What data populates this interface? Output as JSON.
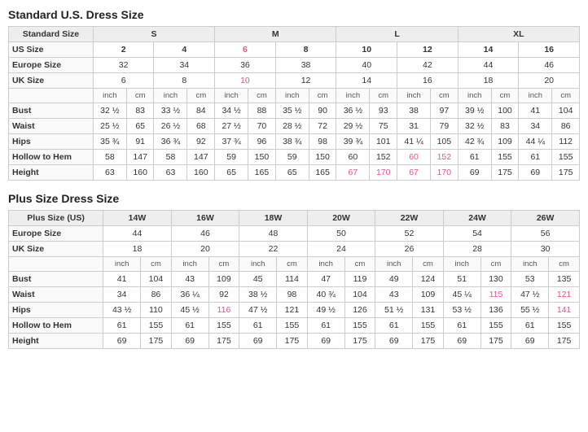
{
  "standard": {
    "title": "Standard U.S. Dress Size",
    "sizeGroups": [
      {
        "label": "Standard Size",
        "span": 1
      },
      {
        "label": "S",
        "span": 4
      },
      {
        "label": "M",
        "span": 4
      },
      {
        "label": "L",
        "span": 4
      },
      {
        "label": "XL",
        "span": 4
      }
    ],
    "usSize": {
      "label": "US Size",
      "values": [
        "2",
        "",
        "4",
        "",
        "6",
        "",
        "8",
        "",
        "10",
        "",
        "12",
        "",
        "14",
        "",
        "16",
        ""
      ]
    },
    "euSize": {
      "label": "Europe Size",
      "values": [
        "32",
        "",
        "34",
        "",
        "36",
        "",
        "38",
        "",
        "40",
        "",
        "42",
        "",
        "44",
        "",
        "46",
        ""
      ]
    },
    "ukSize": {
      "label": "UK Size",
      "values": [
        "6",
        "",
        "8",
        "",
        "10",
        "",
        "12",
        "",
        "14",
        "",
        "16",
        "",
        "18",
        "",
        "20",
        ""
      ]
    },
    "measurements": [
      {
        "label": "Bust",
        "values": [
          "32 ½",
          "83",
          "33 ½",
          "84",
          "34 ½",
          "88",
          "35 ½",
          "90",
          "36 ½",
          "93",
          "38",
          "97",
          "39 ½",
          "100",
          "41",
          "104"
        ]
      },
      {
        "label": "Waist",
        "values": [
          "25 ½",
          "65",
          "26 ½",
          "68",
          "27 ½",
          "70",
          "28 ½",
          "72",
          "29 ½",
          "75",
          "31",
          "79",
          "32 ½",
          "83",
          "34",
          "86"
        ]
      },
      {
        "label": "Hips",
        "values": [
          "35 ¾",
          "91",
          "36 ¾",
          "92",
          "37 ¾",
          "96",
          "38 ¾",
          "98",
          "39 ¾",
          "101",
          "41 ¼",
          "105",
          "42 ¾",
          "109",
          "44 ¼",
          "112"
        ]
      },
      {
        "label": "Hollow to Hem",
        "values": [
          "58",
          "147",
          "58",
          "147",
          "59",
          "150",
          "59",
          "150",
          "60",
          "152",
          "60",
          "152",
          "61",
          "155",
          "61",
          "155"
        ]
      },
      {
        "label": "Height",
        "values": [
          "63",
          "160",
          "63",
          "160",
          "65",
          "165",
          "65",
          "165",
          "67",
          "170",
          "67",
          "170",
          "69",
          "175",
          "69",
          "175"
        ]
      }
    ]
  },
  "plus": {
    "title": "Plus Size Dress Size",
    "sizeGroups": [
      {
        "label": "Plus Size (US)",
        "span": 1
      },
      {
        "label": "14W",
        "span": 2
      },
      {
        "label": "16W",
        "span": 2
      },
      {
        "label": "18W",
        "span": 2
      },
      {
        "label": "20W",
        "span": 2
      },
      {
        "label": "22W",
        "span": 2
      },
      {
        "label": "24W",
        "span": 2
      },
      {
        "label": "26W",
        "span": 2
      }
    ],
    "euSize": {
      "label": "Europe Size",
      "values": [
        "44",
        "",
        "46",
        "",
        "48",
        "",
        "50",
        "",
        "52",
        "",
        "54",
        "",
        "56",
        ""
      ]
    },
    "ukSize": {
      "label": "UK Size",
      "values": [
        "18",
        "",
        "20",
        "",
        "22",
        "",
        "24",
        "",
        "26",
        "",
        "28",
        "",
        "30",
        ""
      ]
    },
    "measurements": [
      {
        "label": "Bust",
        "values": [
          "41",
          "104",
          "43",
          "109",
          "45",
          "114",
          "47",
          "119",
          "49",
          "124",
          "51",
          "130",
          "53",
          "135"
        ]
      },
      {
        "label": "Waist",
        "values": [
          "34",
          "86",
          "36 ¼",
          "92",
          "38 ½",
          "98",
          "40 ¾",
          "104",
          "43",
          "109",
          "45 ¼",
          "115",
          "47 ½",
          "121"
        ]
      },
      {
        "label": "Hips",
        "values": [
          "43 ½",
          "110",
          "45 ½",
          "116",
          "47 ½",
          "121",
          "49 ½",
          "126",
          "51 ½",
          "131",
          "53 ½",
          "136",
          "55 ½",
          "141"
        ]
      },
      {
        "label": "Hollow to Hem",
        "values": [
          "61",
          "155",
          "61",
          "155",
          "61",
          "155",
          "61",
          "155",
          "61",
          "155",
          "61",
          "155",
          "61",
          "155"
        ]
      },
      {
        "label": "Height",
        "values": [
          "69",
          "175",
          "69",
          "175",
          "69",
          "175",
          "69",
          "175",
          "69",
          "175",
          "69",
          "175",
          "69",
          "175"
        ]
      }
    ]
  },
  "units": {
    "inch": "inch",
    "cm": "cm"
  }
}
